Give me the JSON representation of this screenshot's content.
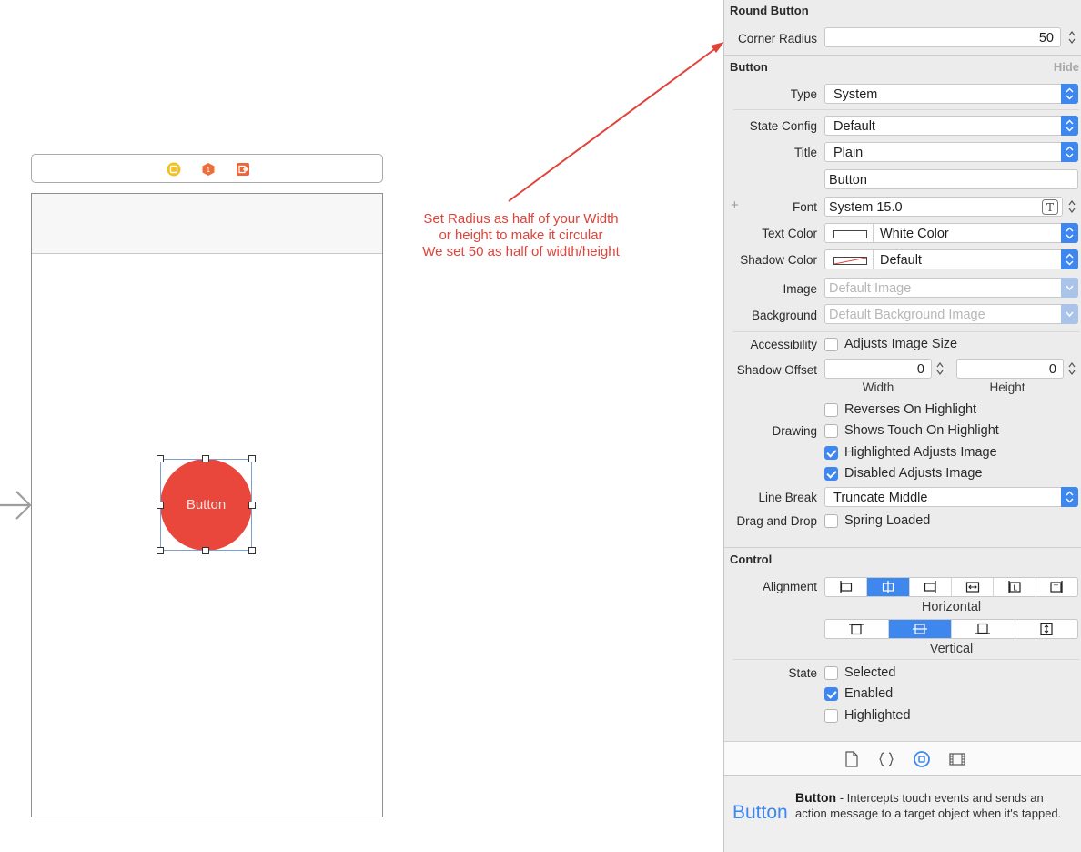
{
  "canvas": {
    "button_label": "Button",
    "annotation": [
      "Set Radius as half of your Width",
      "or height to make it circular",
      "We set 50 as half of width/height"
    ],
    "accent_color": "#e9473c"
  },
  "inspector": {
    "round_button": {
      "header": "Round Button",
      "corner_radius_label": "Corner Radius",
      "corner_radius_value": "50"
    },
    "button": {
      "header": "Button",
      "hide_label": "Hide",
      "type_label": "Type",
      "type_value": "System",
      "state_config_label": "State Config",
      "state_config_value": "Default",
      "title_label": "Title",
      "title_value": "Plain",
      "title_text": "Button",
      "font_label": "Font",
      "font_value": "System 15.0",
      "text_color_label": "Text Color",
      "text_color_value": "White Color",
      "shadow_color_label": "Shadow Color",
      "shadow_color_value": "Default",
      "image_label": "Image",
      "image_placeholder": "Default Image",
      "background_label": "Background",
      "background_placeholder": "Default Background Image",
      "accessibility_label": "Accessibility",
      "adjusts_image_size": "Adjusts Image Size",
      "shadow_offset_label": "Shadow Offset",
      "shadow_offset_width": "0",
      "shadow_offset_height": "0",
      "width_caption": "Width",
      "height_caption": "Height",
      "drawing_label": "Drawing",
      "drawing_options": [
        {
          "label": "Reverses On Highlight",
          "checked": false
        },
        {
          "label": "Shows Touch On Highlight",
          "checked": false
        },
        {
          "label": "Highlighted Adjusts Image",
          "checked": true
        },
        {
          "label": "Disabled Adjusts Image",
          "checked": true
        }
      ],
      "line_break_label": "Line Break",
      "line_break_value": "Truncate Middle",
      "drag_drop_label": "Drag and Drop",
      "spring_loaded": "Spring Loaded"
    },
    "control": {
      "header": "Control",
      "alignment_label": "Alignment",
      "horizontal_caption": "Horizontal",
      "vertical_caption": "Vertical",
      "state_label": "State",
      "states": [
        {
          "label": "Selected",
          "checked": false
        },
        {
          "label": "Enabled",
          "checked": true
        },
        {
          "label": "Highlighted",
          "checked": false
        }
      ]
    },
    "help": {
      "big_title": "Button",
      "title": "Button",
      "description": " - Intercepts touch events and sends an action message to a target object when it's tapped."
    },
    "accent_color": "#3d87ee"
  }
}
